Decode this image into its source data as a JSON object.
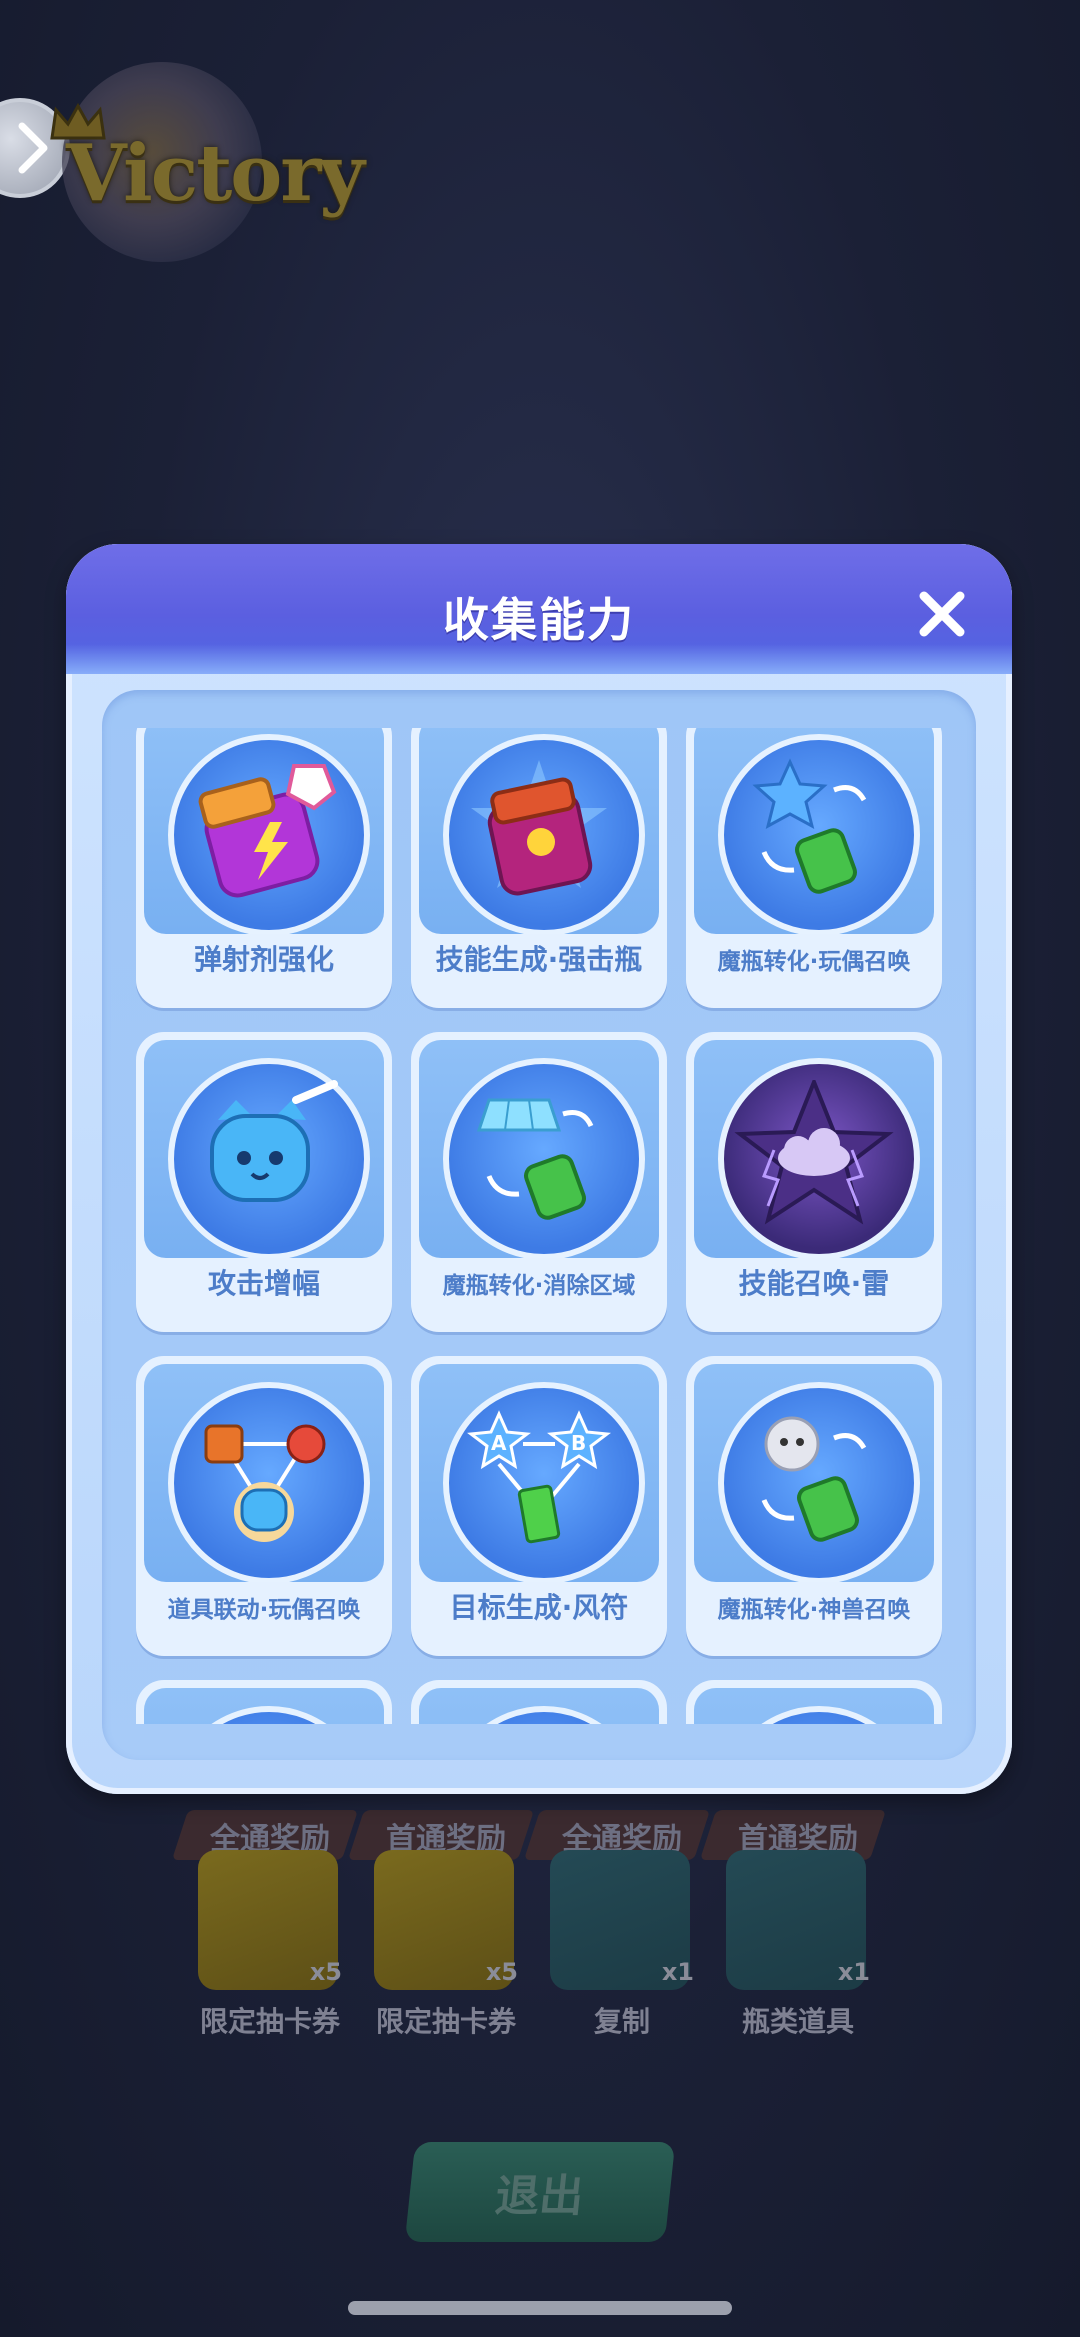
{
  "background": {
    "victory_logo": "Victory",
    "rewards": [
      {
        "ribbon": "全通奖励",
        "count": "x5",
        "name": "限定抽卡券",
        "style": "gold",
        "icon": "play-ticket-icon"
      },
      {
        "ribbon": "首通奖励",
        "count": "x5",
        "name": "限定抽卡券",
        "style": "gold",
        "icon": "play-ticket-icon"
      },
      {
        "ribbon": "全通奖励",
        "count": "x1",
        "name": "复制",
        "style": "teal",
        "icon": "copy-apple-icon"
      },
      {
        "ribbon": "首通奖励",
        "count": "x1",
        "name": "瓶类道具",
        "style": "teal",
        "icon": "bottle-item-icon"
      }
    ],
    "exit_label": "退出"
  },
  "modal": {
    "title": "收集能力",
    "abilities": [
      {
        "label": "弹射剂强化",
        "icon": "purple-bottle-lightning-icon"
      },
      {
        "label": "技能生成·强击瓶",
        "icon": "magenta-bottle-icon"
      },
      {
        "label": "魔瓶转化·玩偶召唤",
        "icon": "bottle-doll-convert-icon"
      },
      {
        "label": "攻击增幅",
        "icon": "blue-doll-sword-icon"
      },
      {
        "label": "魔瓶转化·消除区域",
        "icon": "bottle-area-convert-icon"
      },
      {
        "label": "技能召唤·雷",
        "icon": "thunder-cloud-star-icon"
      },
      {
        "label": "道具联动·玩偶召唤",
        "icon": "item-link-doll-icon"
      },
      {
        "label": "目标生成·风符",
        "icon": "wind-charm-ab-icon"
      },
      {
        "label": "魔瓶转化·神兽召唤",
        "icon": "bottle-beast-convert-icon"
      },
      {
        "label": "",
        "icon": "partial-card-icon"
      },
      {
        "label": "",
        "icon": "partial-card-icon"
      },
      {
        "label": "",
        "icon": "partial-card-icon"
      }
    ]
  }
}
